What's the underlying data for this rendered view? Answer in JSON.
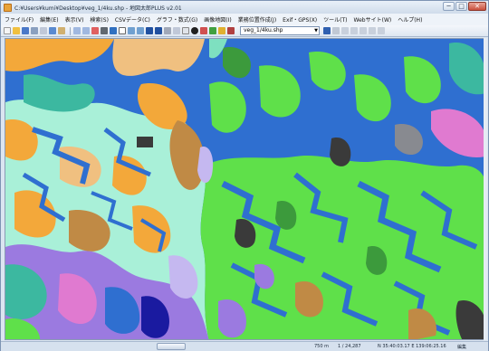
{
  "window": {
    "title": "C:¥Users¥kumi¥Desktop¥veg_1/4ku.shp - 地図太郎PLUS v2.01",
    "minimize": "─",
    "maximize": "□",
    "close": "✕"
  },
  "menu": {
    "items": [
      "ファイル(F)",
      "編集(E)",
      "表示(V)",
      "検索(S)",
      "CSVデータ(C)",
      "グラフ・数式(G)",
      "画像地図(I)",
      "業務位置作成(J)",
      "Exif・GPS(X)",
      "ツール(T)",
      "Webサイト(W)",
      "ヘルプ(H)"
    ]
  },
  "toolbar": {
    "layer_value": "veg_1/4ku.shp",
    "layer_arrow": "▼"
  },
  "statusbar": {
    "scale_distance": "750 m",
    "scale_ratio": "1 / 24,287",
    "coordinates": "N 35:40:03.17  E 139:06:25.16",
    "mode": "編集"
  },
  "map": {
    "colors": {
      "water": "#2f6fd0",
      "green": "#5fe04a",
      "darkgreen": "#3c9a3c",
      "lightcyan": "#a9f0d8",
      "orange": "#f3a83a",
      "peach": "#f0c080",
      "brown": "#c08a45",
      "purple": "#9b7ae0",
      "pink": "#e07ad0",
      "lavender": "#c5b8f0",
      "gray": "#888a90",
      "dark": "#3a3a3a",
      "teal": "#3cb8a0",
      "mint": "#7ee0c0"
    }
  }
}
